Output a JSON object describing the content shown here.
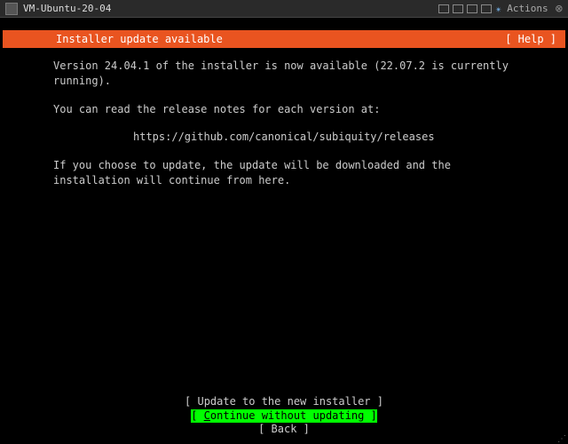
{
  "titlebar": {
    "title": "VM-Ubuntu-20-04",
    "actions_label": "Actions"
  },
  "header": {
    "title": "Installer update available",
    "help": "[ Help ]"
  },
  "body": {
    "p1": "Version 24.04.1 of the installer is now available (22.07.2 is currently running).",
    "p2": "You can read the release notes for each version at:",
    "url": "https://github.com/canonical/subiquity/releases",
    "p3": "If you choose to update, the update will be downloaded and the installation will continue from here."
  },
  "menu": {
    "update": "[ Update to the new installer ]",
    "continue_prefix": "[ ",
    "continue_underline": "C",
    "continue_rest": "ontinue without updating   ",
    "continue_suffix": "]",
    "back": "[ Back                        ]"
  }
}
